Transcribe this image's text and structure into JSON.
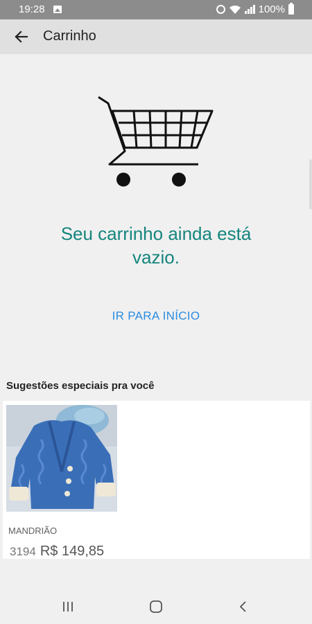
{
  "status_bar": {
    "time": "19:28",
    "battery": "100%",
    "icons": [
      "gallery-icon",
      "alarm-icon",
      "wifi-icon",
      "signal-icon",
      "battery-icon"
    ]
  },
  "app_bar": {
    "title": "Carrinho",
    "back_icon": "arrow-left-icon"
  },
  "empty_state": {
    "illustration": "shopping-cart-icon",
    "message": "Seu carrinho ainda está vazio.",
    "action_label": "IR PARA INÍCIO"
  },
  "suggestions": {
    "title": "Sugestões especiais pra você",
    "products": [
      {
        "brand": "MANDRIÃO",
        "old_price": "3194",
        "price": "R$ 149,85",
        "image": "blue-knitted-cardigan"
      }
    ]
  },
  "nav_bar": {
    "icons": [
      "recent-apps-icon",
      "home-icon",
      "back-icon"
    ]
  },
  "colors": {
    "message": "#15857e",
    "action": "#2c8be0",
    "status_bar": "#8c8c8c",
    "app_bar": "#e0e0e0",
    "background": "#f0f0f0"
  }
}
